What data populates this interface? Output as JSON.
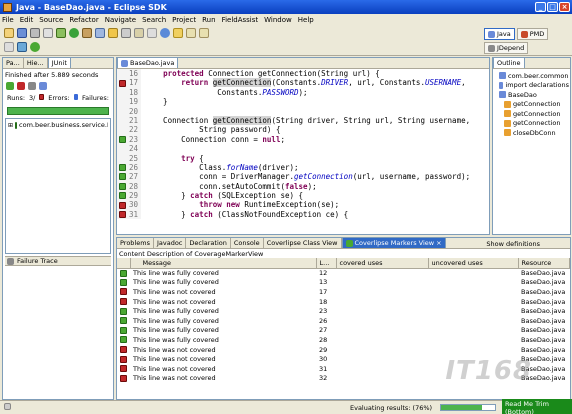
{
  "window": {
    "title": "Java - BaseDao.java - Eclipse SDK"
  },
  "menu": [
    "File",
    "Edit",
    "Source",
    "Refactor",
    "Navigate",
    "Search",
    "Project",
    "Run",
    "FieldAssist",
    "Window",
    "Help"
  ],
  "perspectives": [
    {
      "label": "Java",
      "active": true
    },
    {
      "label": "PMD",
      "active": false
    },
    {
      "label": "JDepend",
      "active": false
    }
  ],
  "left_panel": {
    "tabs": [
      "Pa...",
      "Hie...",
      "JUnit"
    ],
    "status": "Finished after 5.889 seconds",
    "runs_label": "Runs:",
    "runs_value": "3/",
    "errors_label": "Errors:",
    "failures_label": "Failures:",
    "tree_item": "com.beer.business.service.Bee",
    "failure_trace": "Failure Trace"
  },
  "editor": {
    "tab": "BaseDao.java",
    "lines": [
      {
        "num": "16",
        "cov": "",
        "text": [
          {
            "t": "    "
          },
          {
            "t": "protected",
            "c": "kw"
          },
          {
            "t": " Connection getConnection(String url) {"
          }
        ]
      },
      {
        "num": "17",
        "cov": "red",
        "text": [
          {
            "t": "        "
          },
          {
            "t": "return",
            "c": "kw"
          },
          {
            "t": " "
          },
          {
            "t": "getConnection",
            "c": "hl"
          },
          {
            "t": "(Constants."
          },
          {
            "t": "DRIVER",
            "c": "fld"
          },
          {
            "t": ", url, Constants."
          },
          {
            "t": "USERNAME",
            "c": "fld"
          },
          {
            "t": ","
          }
        ]
      },
      {
        "num": "18",
        "cov": "",
        "text": [
          {
            "t": "                Constants."
          },
          {
            "t": "PASSWORD",
            "c": "fld"
          },
          {
            "t": ");"
          }
        ]
      },
      {
        "num": "19",
        "cov": "",
        "text": [
          {
            "t": "    }"
          }
        ]
      },
      {
        "num": "20",
        "cov": "",
        "text": [
          {
            "t": ""
          }
        ]
      },
      {
        "num": "21",
        "cov": "",
        "text": [
          {
            "t": "    Connection "
          },
          {
            "t": "getConnection",
            "c": "hl"
          },
          {
            "t": "(String driver, String url, String username,"
          }
        ]
      },
      {
        "num": "22",
        "cov": "",
        "text": [
          {
            "t": "            String password) {"
          }
        ]
      },
      {
        "num": "23",
        "cov": "green",
        "text": [
          {
            "t": "        Connection conn = "
          },
          {
            "t": "null",
            "c": "kw"
          },
          {
            "t": ";"
          }
        ]
      },
      {
        "num": "24",
        "cov": "",
        "text": [
          {
            "t": ""
          }
        ]
      },
      {
        "num": "25",
        "cov": "",
        "text": [
          {
            "t": "        "
          },
          {
            "t": "try",
            "c": "kw"
          },
          {
            "t": " {"
          }
        ]
      },
      {
        "num": "26",
        "cov": "green",
        "text": [
          {
            "t": "            Class."
          },
          {
            "t": "forName",
            "c": "fld"
          },
          {
            "t": "(driver);"
          }
        ]
      },
      {
        "num": "27",
        "cov": "green",
        "text": [
          {
            "t": "            conn = DriverManager."
          },
          {
            "t": "getConnection",
            "c": "fld"
          },
          {
            "t": "(url, username, password);"
          }
        ]
      },
      {
        "num": "28",
        "cov": "green",
        "text": [
          {
            "t": "            conn.setAutoCommit("
          },
          {
            "t": "false",
            "c": "kw"
          },
          {
            "t": ");"
          }
        ]
      },
      {
        "num": "29",
        "cov": "green",
        "text": [
          {
            "t": "        } "
          },
          {
            "t": "catch",
            "c": "kw"
          },
          {
            "t": " (SQLException se) {"
          }
        ]
      },
      {
        "num": "30",
        "cov": "red",
        "text": [
          {
            "t": "            "
          },
          {
            "t": "throw",
            "c": "kw"
          },
          {
            "t": " "
          },
          {
            "t": "new",
            "c": "kw"
          },
          {
            "t": " RuntimeException(se);"
          }
        ]
      },
      {
        "num": "31",
        "cov": "red",
        "text": [
          {
            "t": "        } "
          },
          {
            "t": "catch",
            "c": "kw"
          },
          {
            "t": " (ClassNotFoundException ce) {"
          }
        ]
      }
    ]
  },
  "outline": {
    "tab": "Outline",
    "items": [
      {
        "label": "com.beer.common",
        "indent": 1
      },
      {
        "label": "import declarations",
        "indent": 1
      },
      {
        "label": "BaseDao",
        "indent": 1
      },
      {
        "label": "getConnection",
        "indent": 2
      },
      {
        "label": "getConnection",
        "indent": 2
      },
      {
        "label": "getConnection",
        "indent": 2
      },
      {
        "label": "closeDbConn",
        "indent": 2
      }
    ]
  },
  "bottom": {
    "tabs": [
      "Problems",
      "Javadoc",
      "Declaration",
      "Console",
      "Coverlipse Class View",
      "Coverlipse Markers View"
    ],
    "active_tab": "Coverlipse Markers View",
    "show_definitions": "Show definitions",
    "description": "Content Description of CoverageMarkerView",
    "columns": [
      "Message",
      "L...",
      "covered uses",
      "uncovered uses",
      "Resource"
    ],
    "rows": [
      {
        "status": "green",
        "message": "This line was fully covered",
        "line": "12",
        "resource": "BaseDao.java"
      },
      {
        "status": "green",
        "message": "This line was fully covered",
        "line": "13",
        "resource": "BaseDao.java"
      },
      {
        "status": "red",
        "message": "This line was not covered",
        "line": "17",
        "resource": "BaseDao.java"
      },
      {
        "status": "red",
        "message": "This line was not covered",
        "line": "18",
        "resource": "BaseDao.java"
      },
      {
        "status": "green",
        "message": "This line was fully covered",
        "line": "23",
        "resource": "BaseDao.java"
      },
      {
        "status": "green",
        "message": "This line was fully covered",
        "line": "26",
        "resource": "BaseDao.java"
      },
      {
        "status": "green",
        "message": "This line was fully covered",
        "line": "27",
        "resource": "BaseDao.java"
      },
      {
        "status": "green",
        "message": "This line was fully covered",
        "line": "28",
        "resource": "BaseDao.java"
      },
      {
        "status": "red",
        "message": "This line was not covered",
        "line": "29",
        "resource": "BaseDao.java"
      },
      {
        "status": "red",
        "message": "This line was not covered",
        "line": "30",
        "resource": "BaseDao.java"
      },
      {
        "status": "red",
        "message": "This line was not covered",
        "line": "31",
        "resource": "BaseDao.java"
      },
      {
        "status": "red",
        "message": "This line was not covered",
        "line": "32",
        "resource": "BaseDao.java"
      }
    ]
  },
  "statusbar": {
    "evaluating": "Evaluating results: (76%)",
    "evaluating_progress": 0.76,
    "trim": "Read Me Trim (Bottom)"
  },
  "watermark": "IT168",
  "colors": {
    "covered": "#4aa832",
    "uncovered": "#c0282a",
    "selection": "#316ac5",
    "junit_bar": "#4db34d"
  },
  "icons": [
    "new-icon",
    "save-icon",
    "print-icon",
    "debug-icon",
    "run-icon",
    "search-icon",
    "java-perspective-icon",
    "pmd-icon",
    "jdepend-icon",
    "package-icon",
    "class-icon",
    "method-icon"
  ]
}
